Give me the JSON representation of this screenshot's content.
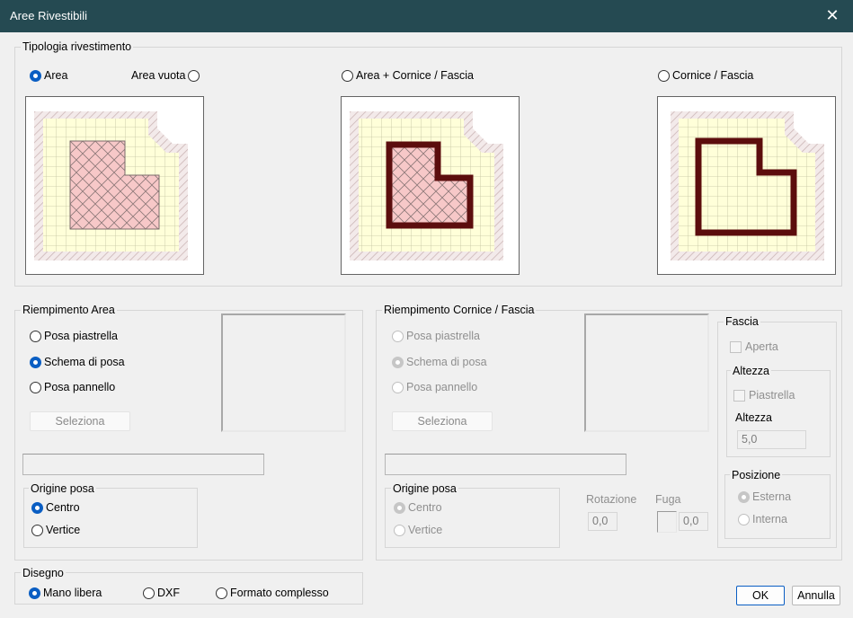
{
  "window": {
    "title": "Aree Rivestibili",
    "close_glyph": "✕"
  },
  "tipologia": {
    "legend": "Tipologia rivestimento",
    "options": [
      {
        "label": "Area",
        "selected": true
      },
      {
        "label": "Area vuota",
        "selected": false
      },
      {
        "label": "Area + Cornice / Fascia",
        "selected": false
      },
      {
        "label": "Cornice / Fascia",
        "selected": false
      }
    ]
  },
  "riempimento_area": {
    "legend": "Riempimento Area",
    "options": [
      {
        "label": "Posa piastrella",
        "selected": false
      },
      {
        "label": "Schema di posa",
        "selected": true
      },
      {
        "label": "Posa pannello",
        "selected": false
      }
    ],
    "select_button": "Seleziona",
    "origine": {
      "legend": "Origine posa",
      "options": [
        {
          "label": "Centro",
          "selected": true
        },
        {
          "label": "Vertice",
          "selected": false
        }
      ]
    }
  },
  "riempimento_cornice": {
    "legend": "Riempimento Cornice / Fascia",
    "options": [
      {
        "label": "Posa piastrella",
        "selected": false
      },
      {
        "label": "Schema di posa",
        "selected": true
      },
      {
        "label": "Posa pannello",
        "selected": false
      }
    ],
    "select_button": "Seleziona",
    "origine": {
      "legend": "Origine posa",
      "options": [
        {
          "label": "Centro",
          "selected": true
        },
        {
          "label": "Vertice",
          "selected": false
        }
      ]
    },
    "rotazione": {
      "label": "Rotazione",
      "value": "0,0"
    },
    "fuga": {
      "label": "Fuga",
      "value": "0,0"
    }
  },
  "fascia": {
    "legend": "Fascia",
    "aperta_label": "Aperta",
    "altezza": {
      "legend": "Altezza",
      "piastrella_label": "Piastrella",
      "altezza_label": "Altezza",
      "value": "5,0"
    },
    "posizione": {
      "legend": "Posizione",
      "options": [
        {
          "label": "Esterna",
          "selected": true
        },
        {
          "label": "Interna",
          "selected": false
        }
      ]
    }
  },
  "disegno": {
    "legend": "Disegno",
    "options": [
      {
        "label": "Mano libera",
        "selected": true
      },
      {
        "label": "DXF",
        "selected": false
      },
      {
        "label": "Formato complesso",
        "selected": false
      }
    ]
  },
  "buttons": {
    "ok": "OK",
    "cancel": "Annulla"
  },
  "colors": {
    "titlebar": "#254a52",
    "accent": "#0a5ec3",
    "tile_fill": "#ffffd9",
    "area_fill": "#f5c6c6",
    "frame_color": "#5c0d0d"
  }
}
